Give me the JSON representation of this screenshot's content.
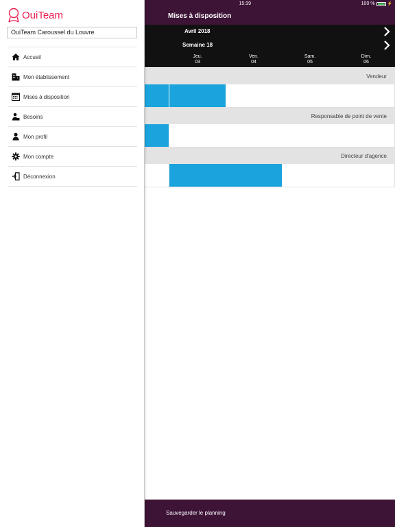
{
  "status": {
    "time": "15:39",
    "battery": "100 %"
  },
  "header": {
    "title": "Mises à disposition"
  },
  "calendar": {
    "month": "Avril 2018",
    "week": "Semaine 18",
    "days": [
      {
        "name": ".",
        "num": ""
      },
      {
        "name": "Jeu.",
        "num": "03"
      },
      {
        "name": "Ven.",
        "num": "04"
      },
      {
        "name": "Sam.",
        "num": "05"
      },
      {
        "name": "Dim.",
        "num": "06"
      }
    ]
  },
  "sections": [
    {
      "title": "Vendeur",
      "filled": [
        true,
        true,
        false,
        false,
        false
      ]
    },
    {
      "title": "Responsable de point de vente",
      "filled": [
        true,
        false,
        false,
        false,
        false
      ]
    },
    {
      "title": "Directeur d'agence",
      "filled": [
        false,
        true,
        true,
        false,
        false
      ]
    }
  ],
  "footer": {
    "save_label": "Sauvegarder le planning"
  },
  "sidebar": {
    "brand": "OuiTeam",
    "establishment": "OuiTeam Caroussel du Louvre",
    "items": [
      {
        "label": "Accueil",
        "icon": "home-icon"
      },
      {
        "label": "Mon établissement",
        "icon": "building-icon"
      },
      {
        "label": "Mises à disposition",
        "icon": "calendar-icon"
      },
      {
        "label": "Besoins",
        "icon": "person-briefcase-icon"
      },
      {
        "label": "Mon profil",
        "icon": "person-icon"
      },
      {
        "label": "Mon compte",
        "icon": "gear-icon"
      },
      {
        "label": "Déconnexion",
        "icon": "logout-icon"
      }
    ]
  },
  "colors": {
    "brand": "#e61e50",
    "header": "#3d1336",
    "filled": "#1aa3dc"
  }
}
